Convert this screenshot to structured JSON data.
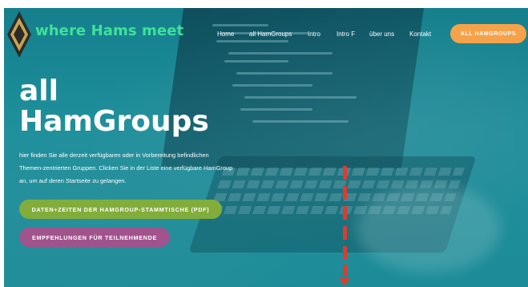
{
  "header": {
    "brand": "where Hams meet",
    "logo": "diamond-badge-logo",
    "nav": [
      {
        "label": "Home"
      },
      {
        "label": "all HamGroups"
      },
      {
        "label": "Intro"
      },
      {
        "label": "Intro F"
      },
      {
        "label": "über uns"
      },
      {
        "label": "Kontakt"
      }
    ],
    "cta": "ALL HAMGROUPS"
  },
  "hero": {
    "title_line1": "all",
    "title_line2": "HamGroups",
    "description_line1": "hier finden Sie alle derzeit verfügbaren oder in Vorbereitung befindlichen",
    "description_line2": "Themen-zentrierten Gruppen. Clicken Sie in der Liste eine verfügbare HamGroup",
    "description_line3": "an, um auf deren Startseite zu gelangen.",
    "button_schedule": "DATEN+ZEITEN DER HAMGROUP-STAMMTISCHE (PDF)",
    "button_recommendations": "EMPFEHLUNGEN FÜR TEILNEHMENDE"
  },
  "colors": {
    "brand_green": "#3ee29a",
    "hero_teal": "#1b8f9c",
    "cta_orange": "#f6a24b",
    "pill_green": "#82ad3b",
    "pill_purple": "#a1538d",
    "arrow_red": "#e03b2e"
  },
  "annotation": "red-dashed-arrow-down"
}
